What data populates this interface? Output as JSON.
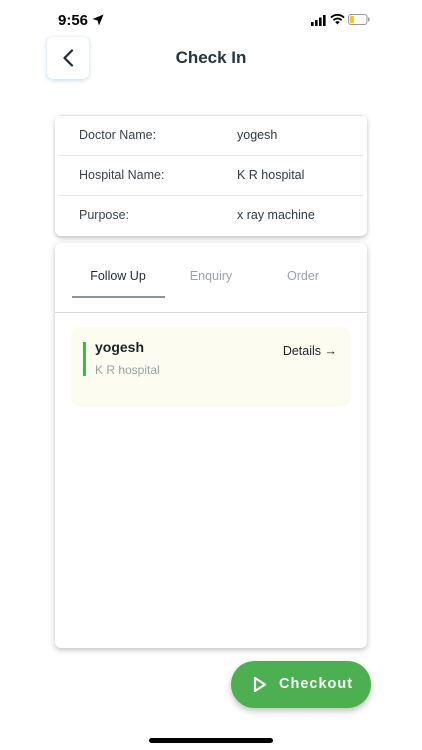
{
  "status_bar": {
    "time": "9:56",
    "icons": [
      "location-arrow-icon",
      "cellular-signal-icon",
      "wifi-icon",
      "battery-low-icon"
    ]
  },
  "header": {
    "back_icon": "chevron-left-icon",
    "title": "Check In"
  },
  "info": {
    "rows": [
      {
        "label": "Doctor Name:",
        "value": "yogesh"
      },
      {
        "label": "Hospital Name:",
        "value": "K R hospital"
      },
      {
        "label": "Purpose:",
        "value": "x ray machine"
      }
    ]
  },
  "tabs": [
    {
      "label": "Follow Up",
      "active": true
    },
    {
      "label": "Enquiry",
      "active": false
    },
    {
      "label": "Order",
      "active": false
    }
  ],
  "entries": [
    {
      "name": "yogesh",
      "hospital": "K R hospital",
      "link_label": "Details →"
    }
  ],
  "checkout": {
    "label": "Checkout",
    "icon": "play-icon"
  },
  "colors": {
    "accent": "#4caf50",
    "entry_bg": "#fcfcf1",
    "title": "#243642"
  }
}
